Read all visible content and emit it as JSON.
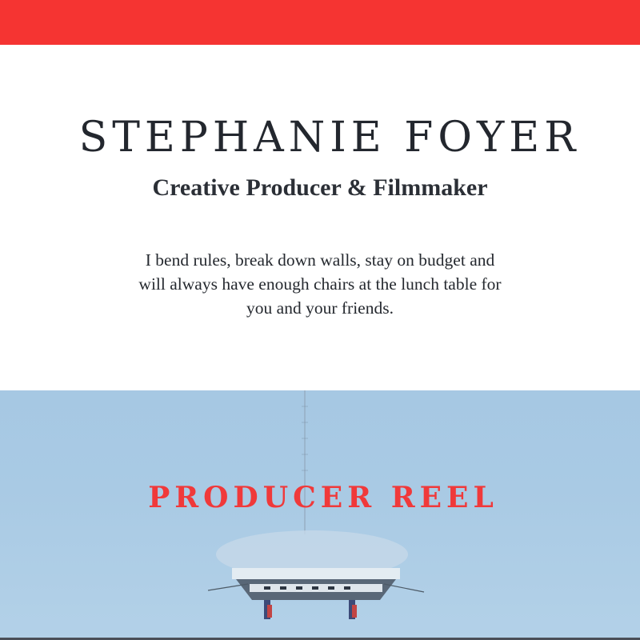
{
  "header": {
    "name": "STEPHANIE FOYER",
    "tagline": "Creative Producer & Filmmaker"
  },
  "bio": {
    "line1": "I bend rules, break down walls, stay on budget and",
    "line2": "will always have enough chairs at the lunch table for",
    "line3": "you and your friends."
  },
  "reel": {
    "title": "PRODUCER REEL"
  },
  "colors": {
    "accent": "#f53432",
    "text": "#23272e",
    "reel_sky": "#a9cae4"
  }
}
